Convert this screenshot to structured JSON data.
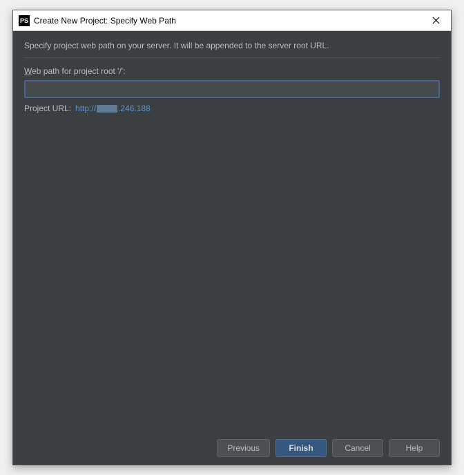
{
  "window": {
    "app_icon_text": "PS",
    "title": "Create New Project: Specify Web Path"
  },
  "content": {
    "description": "Specify project web path on your server. It will be appended to the server root URL.",
    "field_label_mnemonic": "W",
    "field_label_rest": "eb path for project root '/':",
    "input_value": "",
    "url_label": "Project URL:",
    "url_prefix": "http://",
    "url_suffix": ".246.188"
  },
  "buttons": {
    "previous": "Previous",
    "finish": "Finish",
    "cancel": "Cancel",
    "help": "Help"
  }
}
